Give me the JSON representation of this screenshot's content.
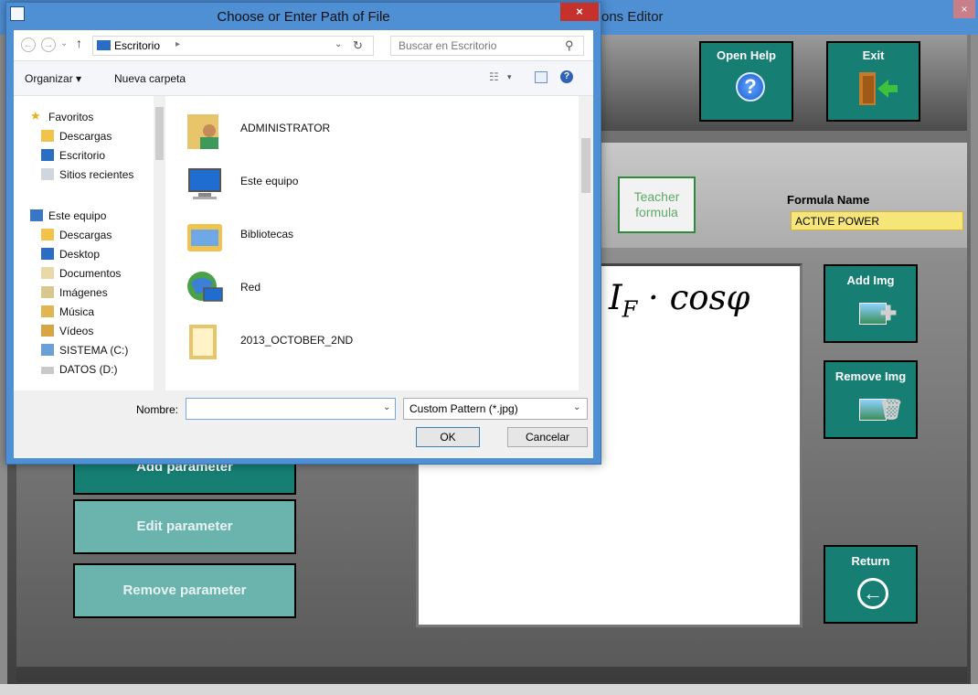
{
  "app": {
    "title": "ons Editor",
    "close_glyph": "×",
    "open_help_label": "Open Help",
    "exit_label": "Exit",
    "teacher_formula": "Teacher formula",
    "formula_name_label": "Formula Name",
    "formula_name_value": "ACTIVE POWER",
    "add_parameter": "Add parameter",
    "edit_parameter": "Edit parameter",
    "remove_parameter": "Remove parameter",
    "add_img": "Add Img",
    "remove_img": "Remove Img",
    "return_label": "Return",
    "formula": "I_F · cosφ",
    "formula_base": "I",
    "formula_sub": "F",
    "formula_rest": " · cosφ"
  },
  "dialog": {
    "title": "Choose or Enter Path of File",
    "close_glyph": "×",
    "address": "Escritorio",
    "search_placeholder": "Buscar en Escritorio",
    "organize": "Organizar ▾",
    "new_folder": "Nueva carpeta",
    "nav_items": [
      {
        "label": "Favoritos",
        "icon": "star-icon"
      },
      {
        "label": "Descargas",
        "icon": "downloads-icon"
      },
      {
        "label": "Escritorio",
        "icon": "desktop-icon"
      },
      {
        "label": "Sitios recientes",
        "icon": "recent-icon"
      },
      {
        "label": "Este equipo",
        "icon": "computer-icon"
      },
      {
        "label": "Descargas",
        "icon": "downloads-icon"
      },
      {
        "label": "Desktop",
        "icon": "desktop-icon"
      },
      {
        "label": "Documentos",
        "icon": "documents-icon"
      },
      {
        "label": "Imágenes",
        "icon": "pictures-icon"
      },
      {
        "label": "Música",
        "icon": "music-icon"
      },
      {
        "label": "Vídeos",
        "icon": "videos-icon"
      },
      {
        "label": "SISTEMA (C:)",
        "icon": "drive-icon"
      },
      {
        "label": "DATOS (D:)",
        "icon": "drive-icon"
      }
    ],
    "files": [
      {
        "name": "ADMINISTRATOR",
        "icon": "user-folder-icon"
      },
      {
        "name": "Este equipo",
        "icon": "computer-icon"
      },
      {
        "name": "Bibliotecas",
        "icon": "libraries-icon"
      },
      {
        "name": "Red",
        "icon": "network-icon"
      },
      {
        "name": "2013_OCTOBER_2ND",
        "icon": "folder-icon"
      }
    ],
    "name_label": "Nombre:",
    "name_value": "",
    "file_type": "Custom Pattern (*.jpg)",
    "ok": "OK",
    "cancel": "Cancelar"
  },
  "colors": {
    "teal_button": "#167e73",
    "teal_disabled": "#6bb3ad",
    "title_blue": "#4f8fd4",
    "formula_name_bg": "#f6e67a"
  }
}
